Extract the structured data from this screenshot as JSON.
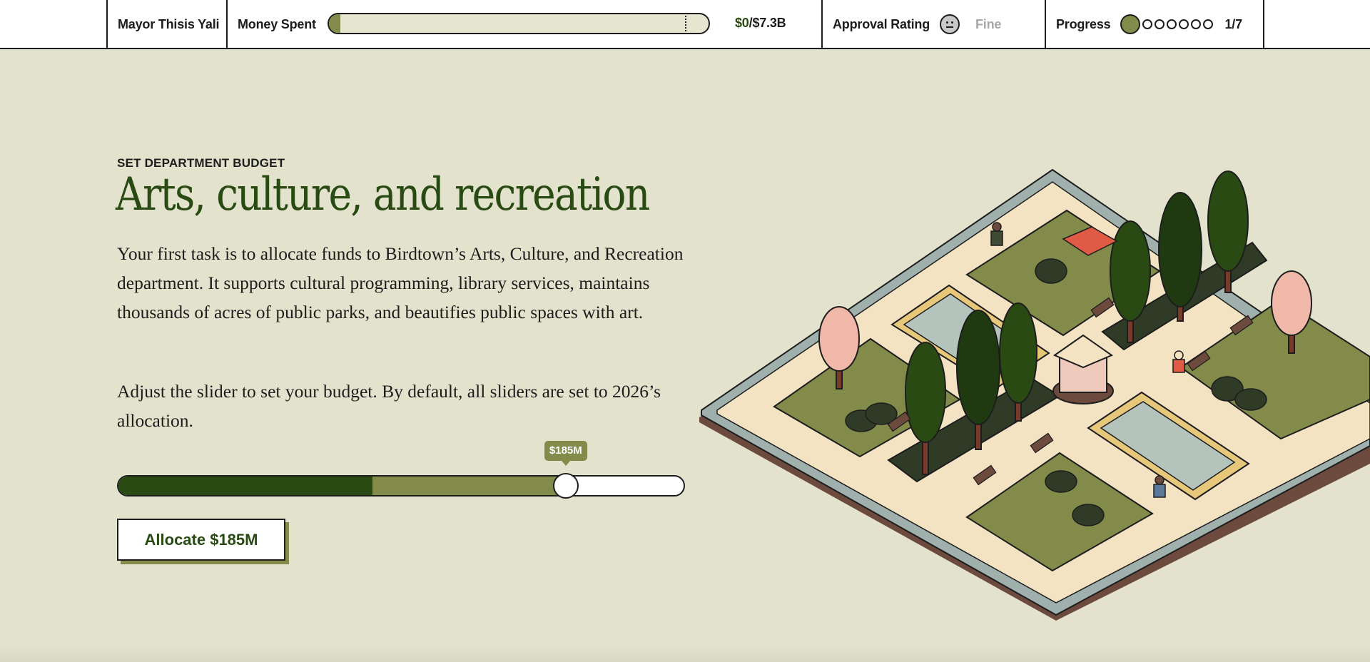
{
  "topbar": {
    "mayor_label": "Mayor Thisis Yali",
    "money_label": "Money Spent",
    "money_spent": "$0",
    "money_separator": "/",
    "money_total": "$7.3B",
    "money_fraction": 0.03,
    "approval_label": "Approval Rating",
    "approval_icon": "neutral-face-icon",
    "approval_status": "Fine",
    "progress_label": "Progress",
    "progress_text": "1/7",
    "progress_current": 1,
    "progress_total": 7
  },
  "main": {
    "eyebrow": "SET DEPARTMENT BUDGET",
    "title": "Arts, culture, and recreation",
    "paragraph_1": "Your first task is to allocate funds to Birdtown’s Arts, Culture, and Recreation department. It supports cultural programming, library services, maintains thousands of acres of public parks, and beautifies public spaces with art.",
    "paragraph_2": "Adjust the slider to set your budget. By default, all sliders are set to 2026’s allocation."
  },
  "slider": {
    "tooltip": "$185M",
    "dark_fraction": 0.45,
    "value_fraction": 0.79
  },
  "allocate_button": {
    "label": "Allocate $185M"
  },
  "colors": {
    "background": "#e2e2cd",
    "dark_green": "#2a4a14",
    "olive": "#838b4a",
    "ink": "#1d1d1d"
  }
}
